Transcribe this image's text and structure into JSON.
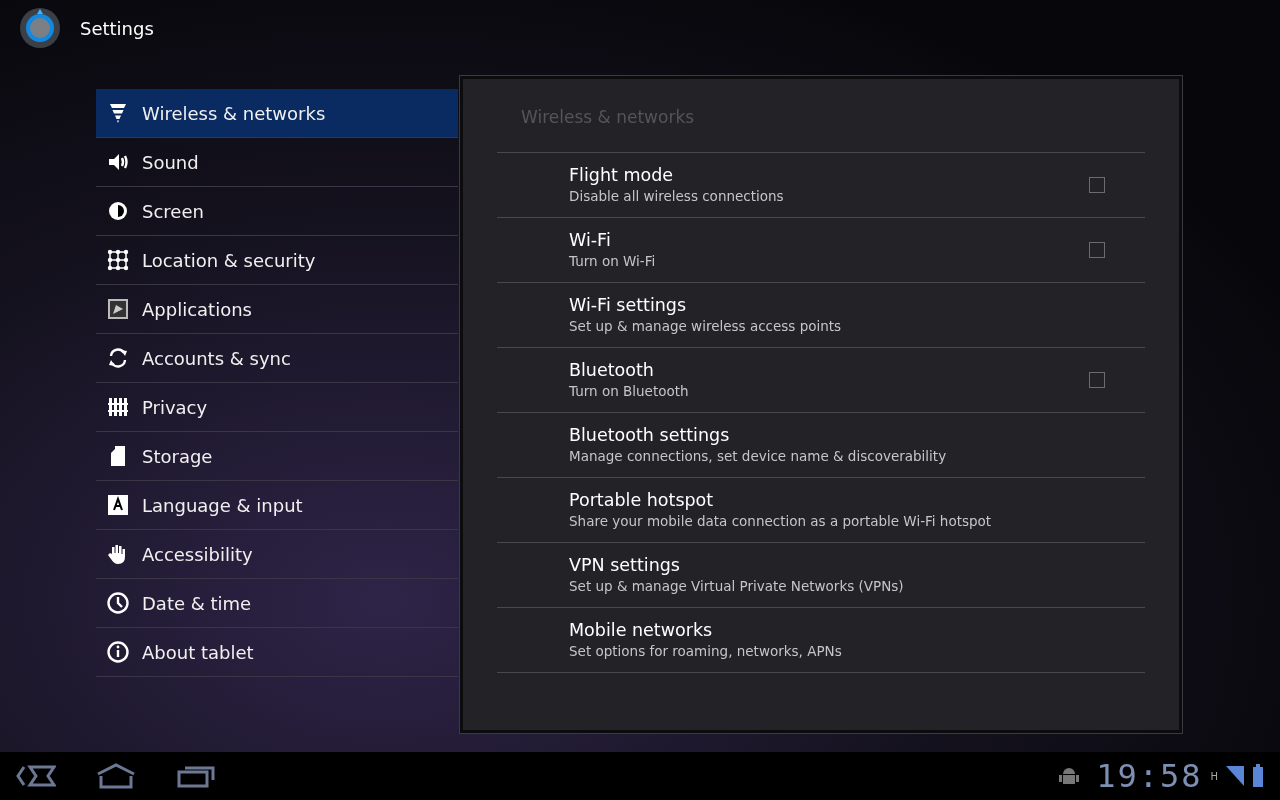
{
  "app_bar": {
    "title": "Settings"
  },
  "sidebar": {
    "items": [
      {
        "label": "Wireless & networks",
        "selected": true
      },
      {
        "label": "Sound",
        "selected": false
      },
      {
        "label": "Screen",
        "selected": false
      },
      {
        "label": "Location & security",
        "selected": false
      },
      {
        "label": "Applications",
        "selected": false
      },
      {
        "label": "Accounts & sync",
        "selected": false
      },
      {
        "label": "Privacy",
        "selected": false
      },
      {
        "label": "Storage",
        "selected": false
      },
      {
        "label": "Language & input",
        "selected": false
      },
      {
        "label": "Accessibility",
        "selected": false
      },
      {
        "label": "Date & time",
        "selected": false
      },
      {
        "label": "About tablet",
        "selected": false
      }
    ]
  },
  "panel": {
    "title": "Wireless & networks",
    "rows": [
      {
        "kind": "checkbox",
        "title": "Flight mode",
        "summary": "Disable all wireless connections",
        "checked": false
      },
      {
        "kind": "checkbox",
        "title": "Wi-Fi",
        "summary": "Turn on Wi-Fi",
        "checked": false
      },
      {
        "kind": "link",
        "title": "Wi-Fi settings",
        "summary": "Set up & manage wireless access points"
      },
      {
        "kind": "checkbox",
        "title": "Bluetooth",
        "summary": "Turn on Bluetooth",
        "checked": false
      },
      {
        "kind": "link",
        "title": "Bluetooth settings",
        "summary": "Manage connections, set device name & discoverability"
      },
      {
        "kind": "link",
        "title": "Portable hotspot",
        "summary": "Share your mobile data connection as a portable Wi-Fi hotspot"
      },
      {
        "kind": "link",
        "title": "VPN settings",
        "summary": "Set up & manage Virtual Private Networks (VPNs)"
      },
      {
        "kind": "link",
        "title": "Mobile networks",
        "summary": "Set options for roaming, networks, APNs"
      }
    ]
  },
  "system_bar": {
    "time": "19:58",
    "network_type": "H"
  }
}
